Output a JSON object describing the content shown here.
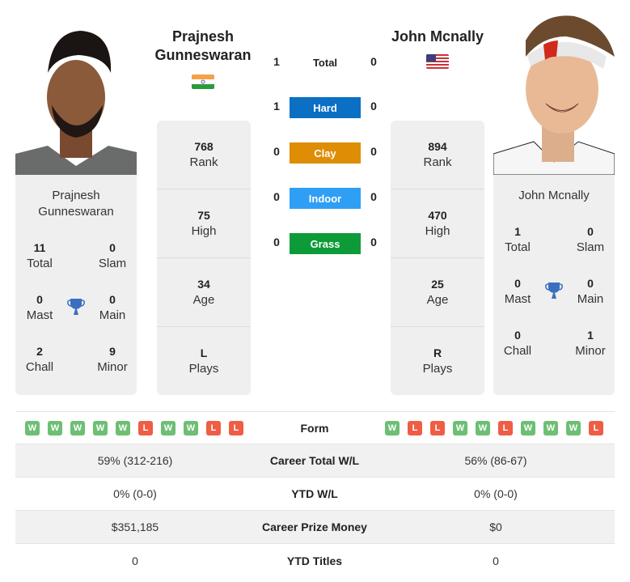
{
  "players": {
    "left": {
      "name": "Prajnesh Gunneswaran",
      "name_line1": "Prajnesh",
      "name_line2": "Gunneswaran",
      "country": "India",
      "flag_icon": "india-flag-icon",
      "stats": [
        {
          "value": "768",
          "label": "Rank"
        },
        {
          "value": "75",
          "label": "High"
        },
        {
          "value": "34",
          "label": "Age"
        },
        {
          "value": "L",
          "label": "Plays"
        }
      ],
      "titles": {
        "total": {
          "value": "11",
          "label": "Total"
        },
        "slam": {
          "value": "0",
          "label": "Slam"
        },
        "mast": {
          "value": "0",
          "label": "Mast"
        },
        "main": {
          "value": "0",
          "label": "Main"
        },
        "chall": {
          "value": "2",
          "label": "Chall"
        },
        "minor": {
          "value": "9",
          "label": "Minor"
        }
      },
      "form": [
        "W",
        "W",
        "W",
        "W",
        "W",
        "L",
        "W",
        "W",
        "L",
        "L"
      ]
    },
    "right": {
      "name": "John Mcnally",
      "country": "USA",
      "flag_icon": "usa-flag-icon",
      "stats": [
        {
          "value": "894",
          "label": "Rank"
        },
        {
          "value": "470",
          "label": "High"
        },
        {
          "value": "25",
          "label": "Age"
        },
        {
          "value": "R",
          "label": "Plays"
        }
      ],
      "titles": {
        "total": {
          "value": "1",
          "label": "Total"
        },
        "slam": {
          "value": "0",
          "label": "Slam"
        },
        "mast": {
          "value": "0",
          "label": "Mast"
        },
        "main": {
          "value": "0",
          "label": "Main"
        },
        "chall": {
          "value": "0",
          "label": "Chall"
        },
        "minor": {
          "value": "1",
          "label": "Minor"
        }
      },
      "form": [
        "W",
        "L",
        "L",
        "W",
        "W",
        "L",
        "W",
        "W",
        "W",
        "L"
      ]
    }
  },
  "h2h": [
    {
      "label": "Total",
      "left": "1",
      "right": "0",
      "color": null
    },
    {
      "label": "Hard",
      "left": "1",
      "right": "0",
      "color": "#0b6fc4"
    },
    {
      "label": "Clay",
      "left": "0",
      "right": "0",
      "color": "#de8d05"
    },
    {
      "label": "Indoor",
      "left": "0",
      "right": "0",
      "color": "#2f9ff5"
    },
    {
      "label": "Grass",
      "left": "0",
      "right": "0",
      "color": "#0d9b3a"
    }
  ],
  "comparison": {
    "form_label": "Form",
    "rows": [
      {
        "label": "Career Total W/L",
        "left": "59% (312-216)",
        "right": "56% (86-67)"
      },
      {
        "label": "YTD W/L",
        "left": "0% (0-0)",
        "right": "0% (0-0)"
      },
      {
        "label": "Career Prize Money",
        "left": "$351,185",
        "right": "$0"
      },
      {
        "label": "YTD Titles",
        "left": "0",
        "right": "0"
      }
    ]
  },
  "colors": {
    "win": "#6dbf73",
    "loss": "#ef5d45",
    "trophy": "#3a6fc0",
    "card_bg": "#efefef"
  }
}
